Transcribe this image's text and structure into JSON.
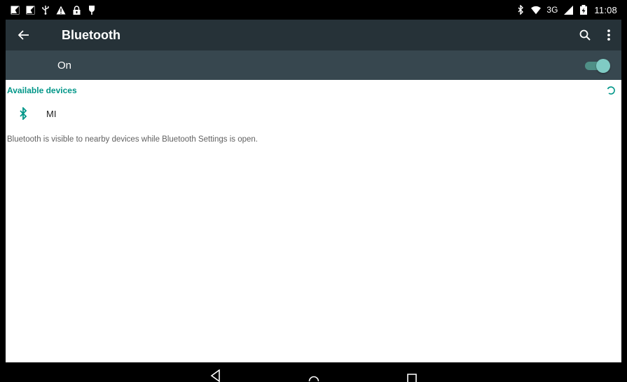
{
  "status_bar": {
    "left_icons": [
      "image-icon",
      "image-icon",
      "usb-icon",
      "warning-icon",
      "lock-icon",
      "pin-icon"
    ],
    "right_icons": [
      "bluetooth-icon",
      "wifi-icon",
      "cell-signal-icon",
      "battery-icon"
    ],
    "network": "3G",
    "time": "11:08"
  },
  "toolbar": {
    "title": "Bluetooth",
    "back_icon": "arrow-back-icon",
    "search_icon": "search-icon",
    "more_icon": "more-vert-icon"
  },
  "switch_bar": {
    "label": "On",
    "enabled": true
  },
  "available_devices": {
    "header": "Available devices",
    "devices": [
      {
        "name": "MI",
        "icon": "bluetooth-icon"
      }
    ]
  },
  "footer_note": "Bluetooth is visible to nearby devices while Bluetooth Settings is open.",
  "nav_bar": {
    "buttons": [
      "back-nav-icon",
      "home-nav-icon",
      "recents-nav-icon"
    ]
  },
  "colors": {
    "toolbar": "#263238",
    "switch_bar": "#37474f",
    "accent": "#009688",
    "switch_thumb": "#80cbc4"
  }
}
